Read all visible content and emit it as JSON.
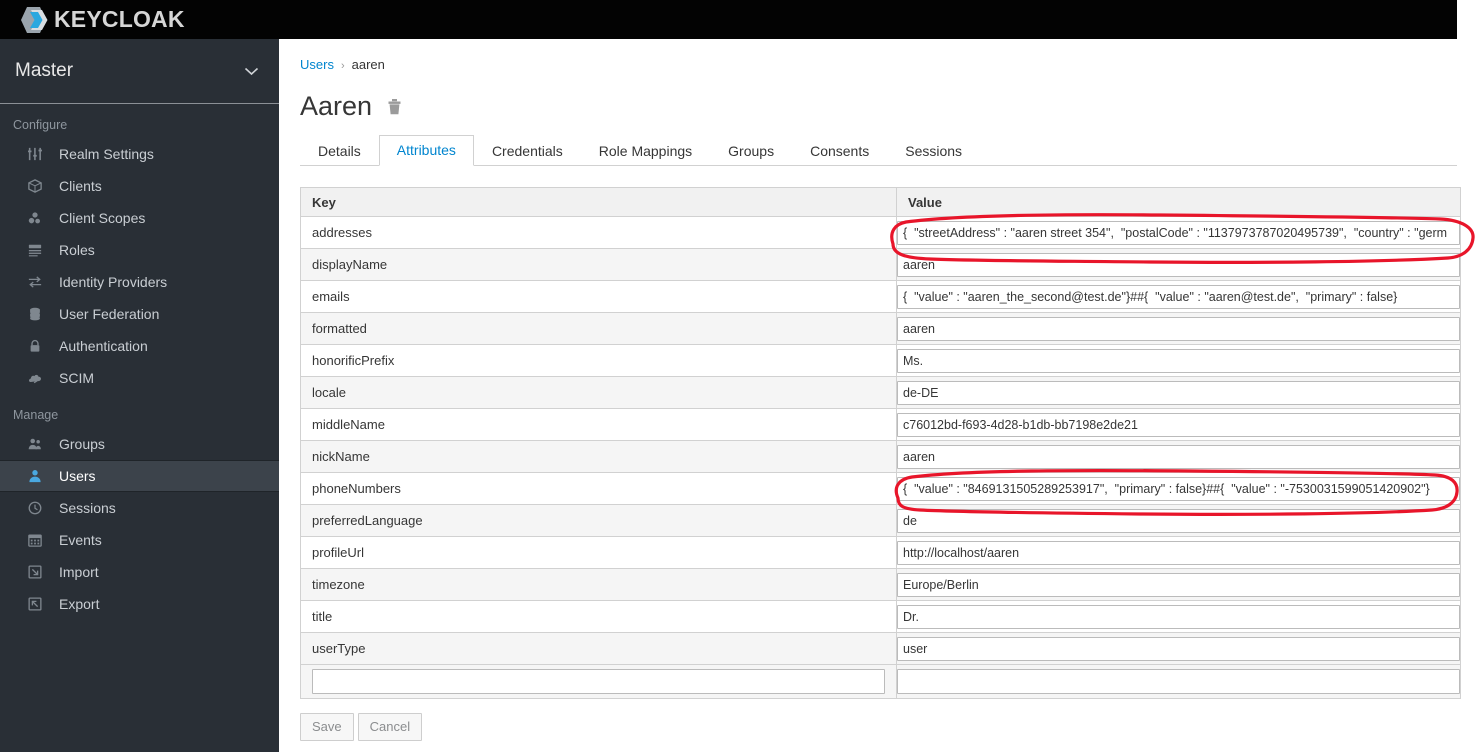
{
  "brand": {
    "name": "KEYCLOAK",
    "logo_icon": "keycloak-logo-icon"
  },
  "sidebar": {
    "realm": {
      "label": "Master",
      "chevron_icon": "chevron-down-icon"
    },
    "groups": [
      {
        "label": "Configure",
        "items": [
          {
            "label": "Realm Settings",
            "icon": "sliders-icon",
            "active": false
          },
          {
            "label": "Clients",
            "icon": "cube-icon",
            "active": false
          },
          {
            "label": "Client Scopes",
            "icon": "cubes-icon",
            "active": false
          },
          {
            "label": "Roles",
            "icon": "list-icon",
            "active": false
          },
          {
            "label": "Identity Providers",
            "icon": "exchange-icon",
            "active": false
          },
          {
            "label": "User Federation",
            "icon": "database-icon",
            "active": false
          },
          {
            "label": "Authentication",
            "icon": "lock-icon",
            "active": false
          },
          {
            "label": "SCIM",
            "icon": "cloud-icon",
            "active": false
          }
        ]
      },
      {
        "label": "Manage",
        "items": [
          {
            "label": "Groups",
            "icon": "users-icon",
            "active": false
          },
          {
            "label": "Users",
            "icon": "user-icon",
            "active": true
          },
          {
            "label": "Sessions",
            "icon": "clock-icon",
            "active": false
          },
          {
            "label": "Events",
            "icon": "calendar-icon",
            "active": false
          },
          {
            "label": "Import",
            "icon": "import-arrow-icon",
            "active": false
          },
          {
            "label": "Export",
            "icon": "export-arrow-icon",
            "active": false
          }
        ]
      }
    ]
  },
  "breadcrumb": {
    "root": "Users",
    "separator": "›",
    "current": "aaren"
  },
  "page": {
    "title": "Aaren",
    "delete_icon": "trash-icon"
  },
  "tabs": [
    {
      "label": "Details",
      "active": false
    },
    {
      "label": "Attributes",
      "active": true
    },
    {
      "label": "Credentials",
      "active": false
    },
    {
      "label": "Role Mappings",
      "active": false
    },
    {
      "label": "Groups",
      "active": false
    },
    {
      "label": "Consents",
      "active": false
    },
    {
      "label": "Sessions",
      "active": false
    }
  ],
  "table": {
    "columns": [
      "Key",
      "Value"
    ],
    "rows": [
      {
        "key": "addresses",
        "value": "{  \"streetAddress\" : \"aaren street 354\",  \"postalCode\" : \"1137973787020495739\",  \"country\" : \"germ"
      },
      {
        "key": "displayName",
        "value": "aaren"
      },
      {
        "key": "emails",
        "value": "{  \"value\" : \"aaren_the_second@test.de\"}##{  \"value\" : \"aaren@test.de\",  \"primary\" : false}"
      },
      {
        "key": "formatted",
        "value": "aaren"
      },
      {
        "key": "honorificPrefix",
        "value": "Ms."
      },
      {
        "key": "locale",
        "value": "de-DE"
      },
      {
        "key": "middleName",
        "value": "c76012bd-f693-4d28-b1db-bb7198e2de21"
      },
      {
        "key": "nickName",
        "value": "aaren"
      },
      {
        "key": "phoneNumbers",
        "value": "{  \"value\" : \"8469131505289253917\",  \"primary\" : false}##{  \"value\" : \"-7530031599051420902\"}"
      },
      {
        "key": "preferredLanguage",
        "value": "de"
      },
      {
        "key": "profileUrl",
        "value": "http://localhost/aaren"
      },
      {
        "key": "timezone",
        "value": "Europe/Berlin"
      },
      {
        "key": "title",
        "value": "Dr."
      },
      {
        "key": "userType",
        "value": "user"
      }
    ],
    "new_row": {
      "key": "",
      "value": "",
      "key_placeholder": "",
      "value_placeholder": ""
    }
  },
  "footer": {
    "save_label": "Save",
    "cancel_label": "Cancel"
  },
  "annotations": {
    "color": "#e8152a",
    "marks": [
      {
        "name": "addresses-value-circle"
      },
      {
        "name": "phone-numbers-value-circle"
      }
    ]
  },
  "colors": {
    "topbar": "#030303",
    "sidebar": "#292f36",
    "sidebar_active": "#3c434b",
    "accent_link": "#0085cf",
    "active_icon": "#4aa8e0",
    "table_header": "#f1f1f1",
    "row_alt": "#f5f5f5",
    "border": "#d1d1d1"
  }
}
